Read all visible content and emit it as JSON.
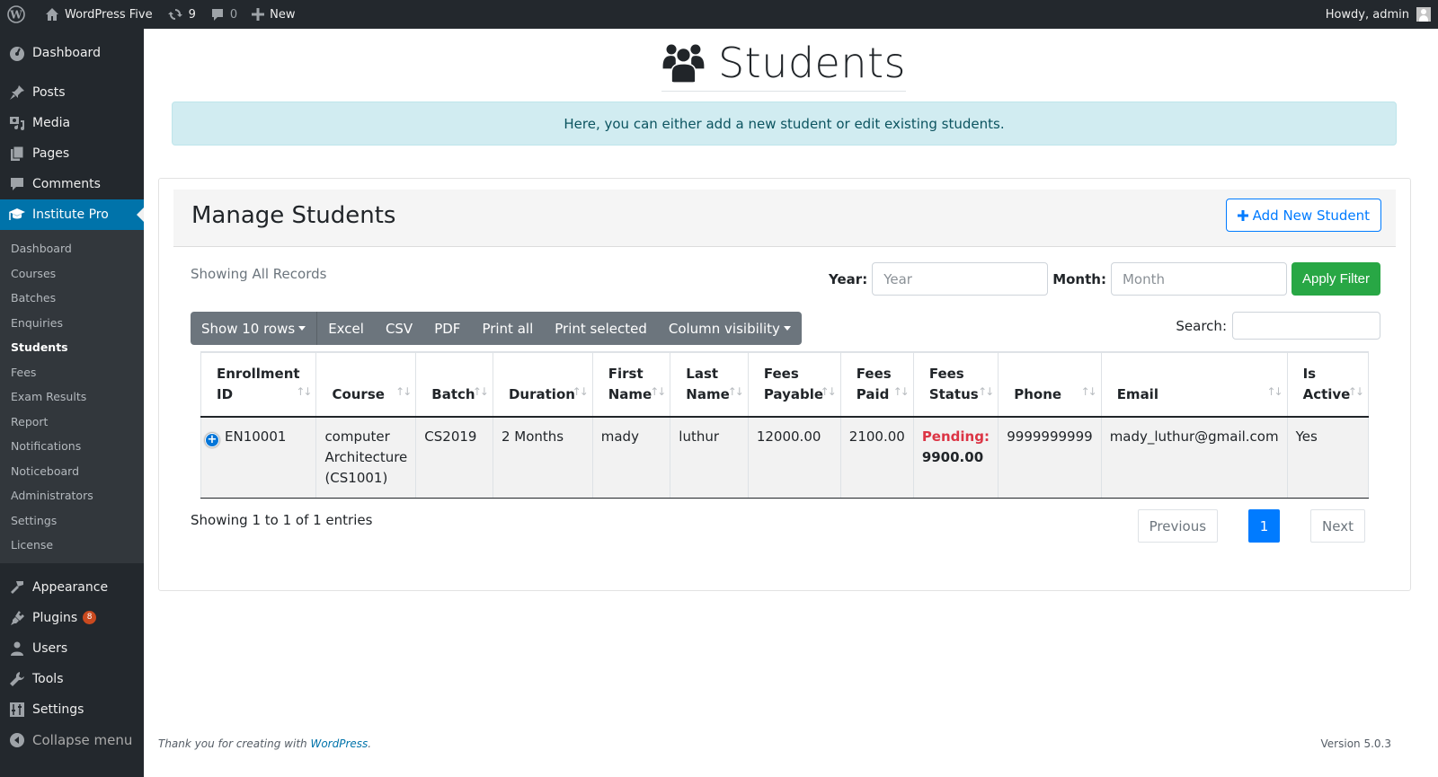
{
  "adminbar": {
    "site_name": "WordPress Five",
    "updates_count": "9",
    "comments_count": "0",
    "new_label": "New",
    "howdy": "Howdy, admin"
  },
  "sidebar": {
    "top_items": [
      {
        "label": "Dashboard",
        "icon": "dashboard-icon"
      },
      {
        "label": "Posts",
        "icon": "pin-icon"
      },
      {
        "label": "Media",
        "icon": "media-icon"
      },
      {
        "label": "Pages",
        "icon": "pages-icon"
      },
      {
        "label": "Comments",
        "icon": "comment-icon"
      },
      {
        "label": "Institute Pro",
        "icon": "graduation-cap-icon",
        "active": true
      }
    ],
    "submenu": [
      "Dashboard",
      "Courses",
      "Batches",
      "Enquiries",
      "Students",
      "Fees",
      "Exam Results",
      "Report",
      "Notifications",
      "Noticeboard",
      "Administrators",
      "Settings",
      "License"
    ],
    "current_submenu": "Students",
    "bottom_items": [
      {
        "label": "Appearance",
        "icon": "paintbrush-icon"
      },
      {
        "label": "Plugins",
        "icon": "plugin-icon",
        "badge": "8"
      },
      {
        "label": "Users",
        "icon": "user-icon"
      },
      {
        "label": "Tools",
        "icon": "wrench-icon"
      },
      {
        "label": "Settings",
        "icon": "settings-icon"
      }
    ],
    "collapse_label": "Collapse menu"
  },
  "page": {
    "title": "Students",
    "title_icon": "users-icon",
    "alert": "Here, you can either add a new student or edit existing students."
  },
  "card": {
    "title": "Manage Students",
    "add_button": "Add New Student",
    "showing_all": "Showing All Records",
    "filter": {
      "year_label": "Year:",
      "year_placeholder": "Year",
      "year_value": "",
      "month_label": "Month:",
      "month_placeholder": "Month",
      "month_value": "",
      "apply_label": "Apply Filter"
    },
    "toolbar": {
      "show_rows": "Show 10 rows",
      "excel": "Excel",
      "csv": "CSV",
      "pdf": "PDF",
      "print_all": "Print all",
      "print_selected": "Print selected",
      "column_visibility": "Column visibility"
    },
    "search_label": "Search:",
    "search_value": ""
  },
  "table": {
    "columns": [
      [
        "Enrollment",
        "ID"
      ],
      [
        "",
        "Course"
      ],
      [
        "",
        "Batch"
      ],
      [
        "",
        "Duration"
      ],
      [
        "First",
        "Name"
      ],
      [
        "Last",
        "Name"
      ],
      [
        "Fees",
        "Payable"
      ],
      [
        "Fees",
        "Paid"
      ],
      [
        "Fees",
        "Status"
      ],
      [
        "",
        "Phone"
      ],
      [
        "",
        "Email"
      ],
      [
        "Is",
        "Active"
      ]
    ],
    "rows": [
      {
        "enrollment_id": "EN10001",
        "course_line1": "computer",
        "course_line2": "Architecture",
        "course_line3": "(CS1001)",
        "batch": "CS2019",
        "duration": "2 Months",
        "first_name": "mady",
        "last_name": "luthur",
        "fees_payable": "12000.00",
        "fees_paid": "2100.00",
        "fees_status_label": "Pending:",
        "fees_status_amount": "9900.00",
        "phone": "9999999999",
        "email": "mady_luthur@gmail.com",
        "is_active": "Yes"
      }
    ]
  },
  "pagination": {
    "info": "Showing 1 to 1 of 1 entries",
    "previous": "Previous",
    "current_page": "1",
    "next": "Next"
  },
  "footer": {
    "thanks_prefix": "Thank you for creating with ",
    "thanks_link": "WordPress",
    "thanks_suffix": ".",
    "version": "Version 5.0.3"
  },
  "colors": {
    "admin_dark": "#23282d",
    "submenu_bg": "#32373c",
    "active_blue": "#0073aa",
    "primary": "#007bff",
    "success": "#28a745",
    "danger": "#dc3545",
    "info_bg": "#d1ecf1",
    "toolbar_gray": "#6c757d"
  }
}
